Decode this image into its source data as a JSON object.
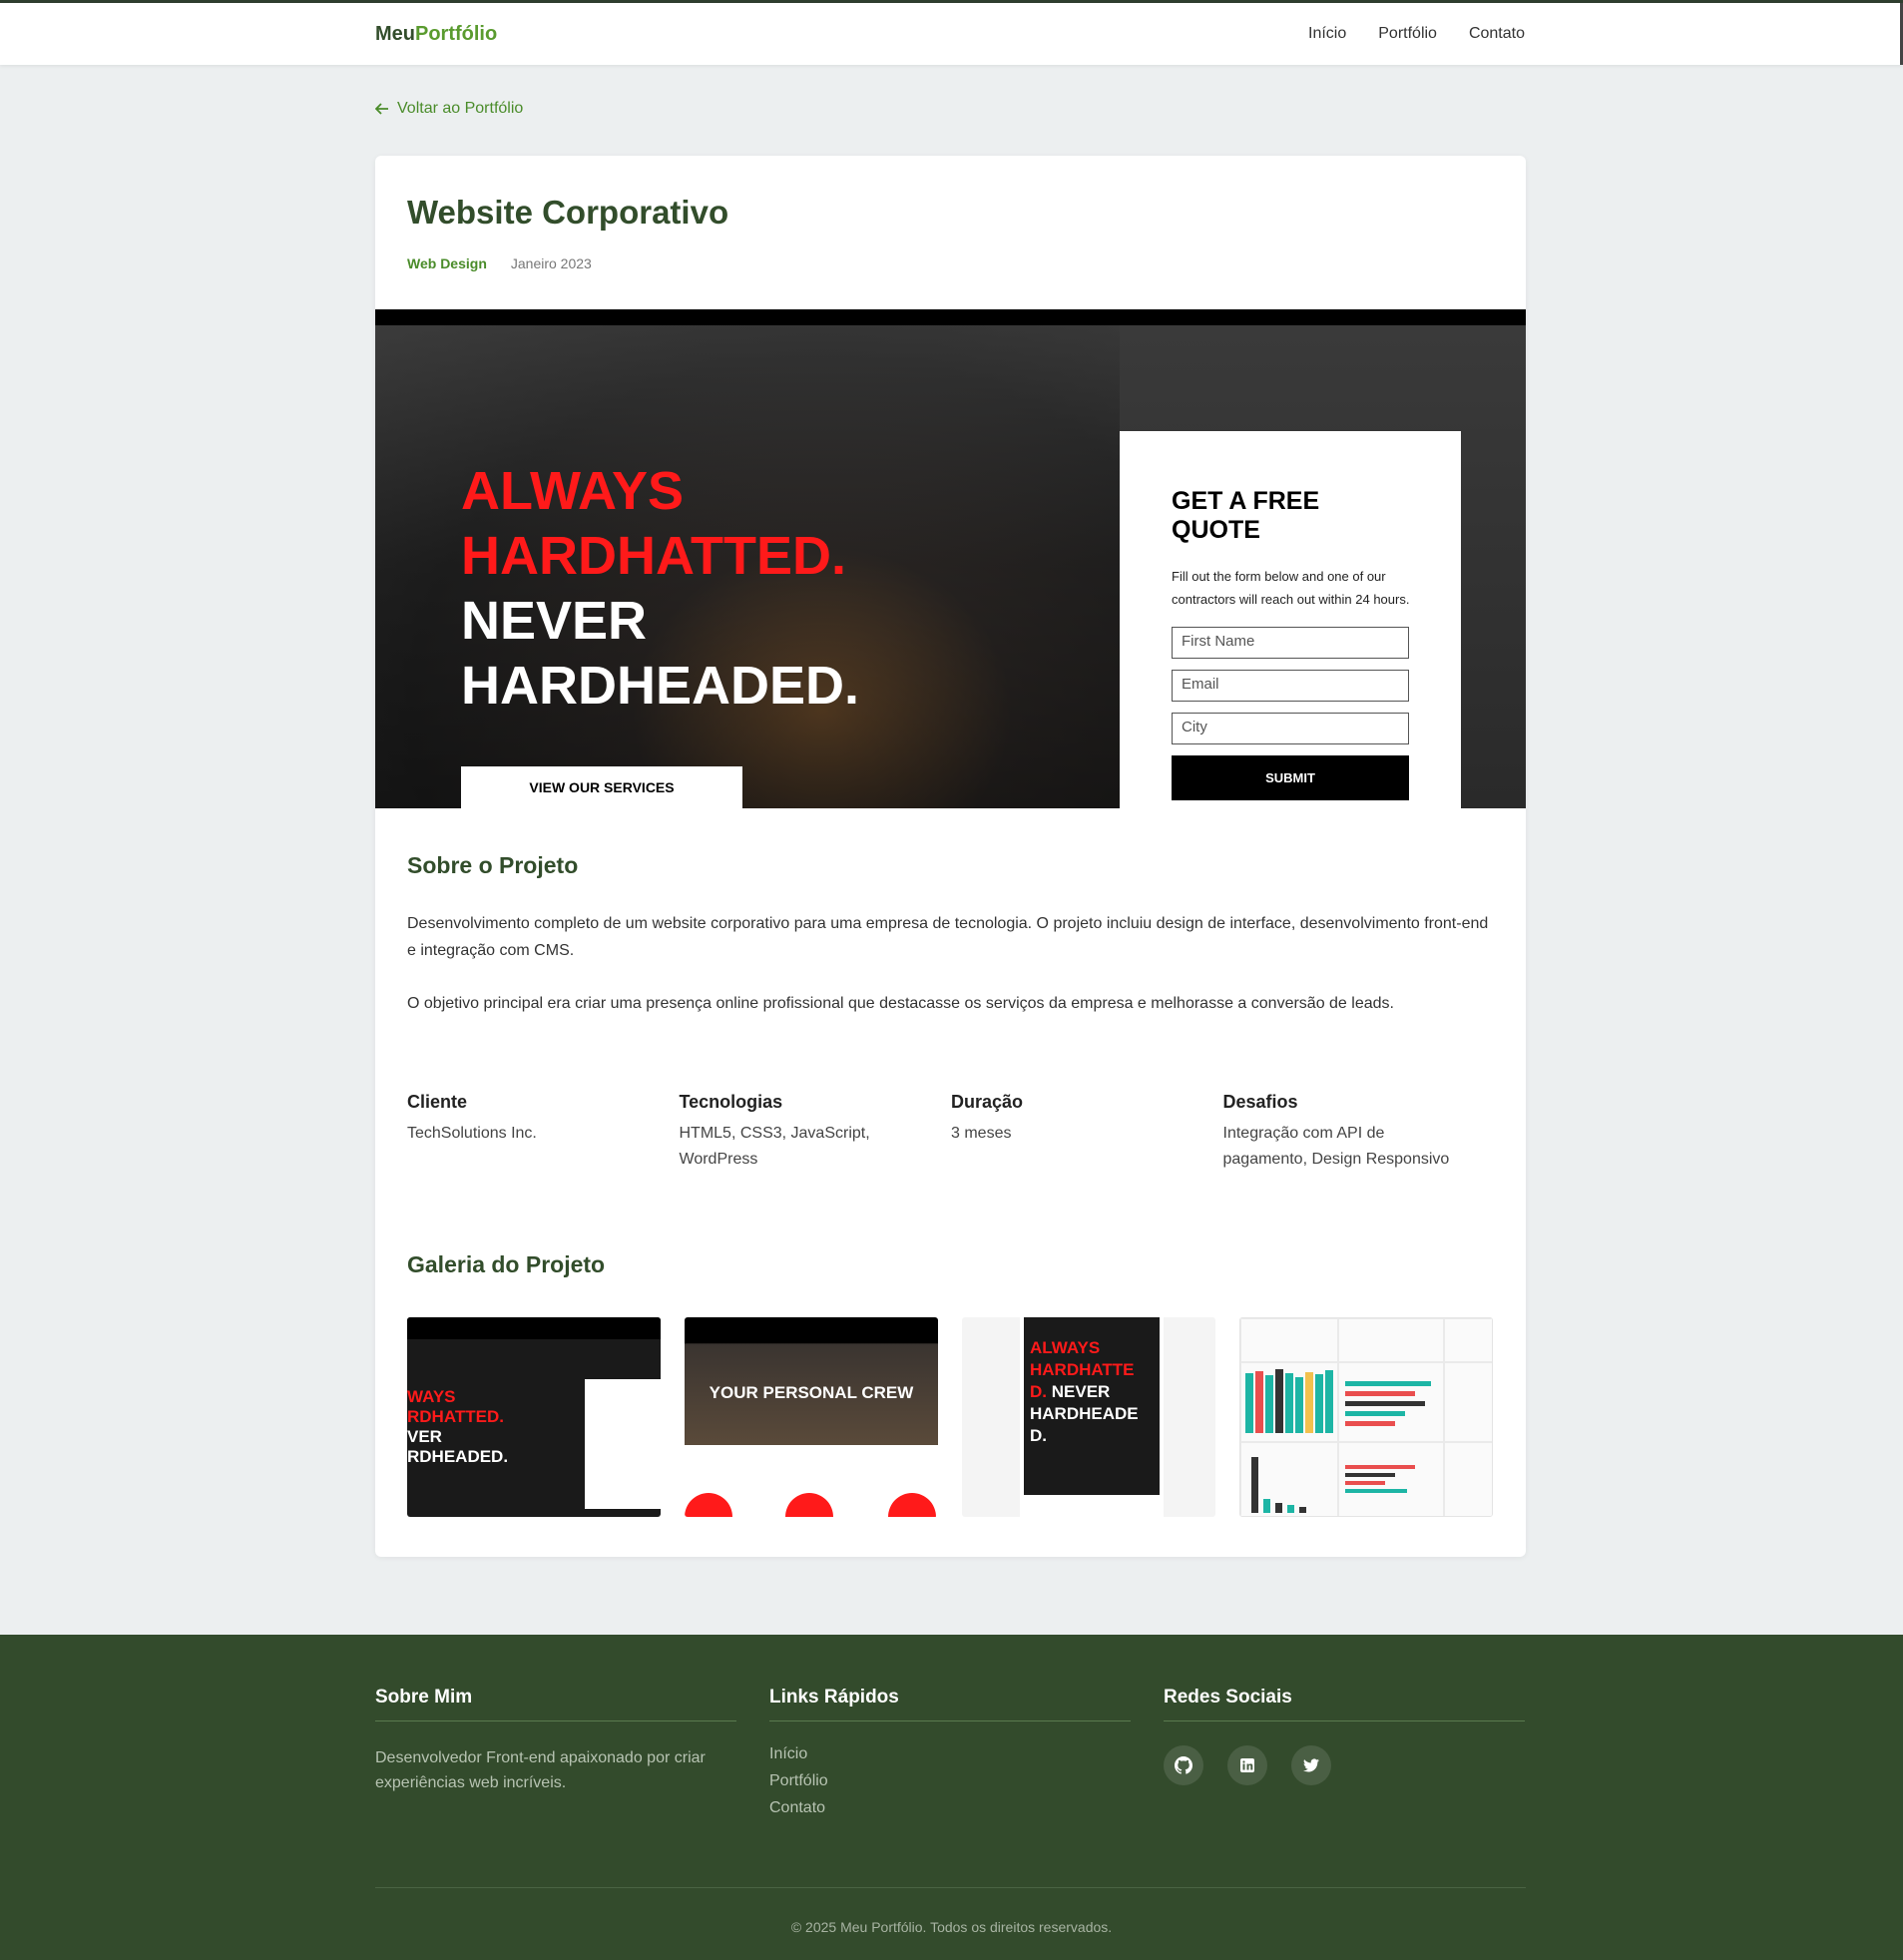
{
  "nav": {
    "brand_part1": "Meu",
    "brand_part2": "Portfólio",
    "links": [
      "Início",
      "Portfólio",
      "Contato"
    ]
  },
  "back_link": "Voltar ao Portfólio",
  "project": {
    "title": "Website Corporativo",
    "category": "Web Design",
    "date": "Janeiro 2023"
  },
  "hero": {
    "headline_red_1": "ALWAYS",
    "headline_red_2": "HARDHATTED.",
    "headline_white_1": "NEVER",
    "headline_white_2": "HARDHEADED.",
    "services_button": "VIEW OUR SERVICES",
    "quote_title": "GET A FREE QUOTE",
    "quote_text": "Fill out the form below and one of our contractors will reach out within 24 hours.",
    "fields": [
      "First Name",
      "Email",
      "City"
    ],
    "submit": "SUBMIT"
  },
  "about": {
    "title": "Sobre o Projeto",
    "paragraphs": [
      "Desenvolvimento completo de um website corporativo para uma empresa de tecnologia. O projeto incluiu design de interface, desenvolvimento front-end e integração com CMS.",
      "O objetivo principal era criar uma presença online profissional que destacasse os serviços da empresa e melhorasse a conversão de leads."
    ]
  },
  "details": [
    {
      "label": "Cliente",
      "value": "TechSolutions Inc."
    },
    {
      "label": "Tecnologias",
      "value": "HTML5, CSS3, JavaScript, WordPress"
    },
    {
      "label": "Duração",
      "value": "3 meses"
    },
    {
      "label": "Desafios",
      "value": "Integração com API de pagamento, Design Responsivo"
    }
  ],
  "gallery": {
    "title": "Galeria do Projeto",
    "thumb1_lines": [
      "WAYS",
      "RDHATTED.",
      "VER",
      "RDHEADED."
    ],
    "thumb2_text": "YOUR PERSONAL CREW",
    "thumb3_lines": [
      "ALWAYS",
      "HARDHATTE",
      "D.",
      "NEVER",
      "HARDHEADE",
      "D."
    ]
  },
  "footer": {
    "about_title": "Sobre Mim",
    "about_text": "Desenvolvedor Front-end apaixonado por criar experiências web incríveis.",
    "links_title": "Links Rápidos",
    "links": [
      "Início",
      "Portfólio",
      "Contato"
    ],
    "social_title": "Redes Sociais",
    "social_icons": [
      "github-icon",
      "linkedin-icon",
      "twitter-icon"
    ],
    "copyright": "© 2025 Meu Portfólio. Todos os direitos reservados."
  },
  "colors": {
    "brand_dark": "#324d2b",
    "brand_accent": "#5a9b2f",
    "footer_bg": "#334b2c",
    "hero_red": "#ff1a1a"
  }
}
